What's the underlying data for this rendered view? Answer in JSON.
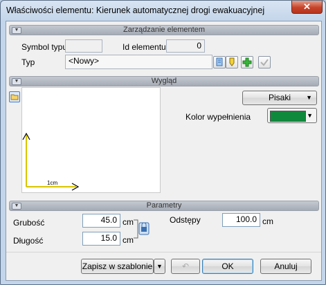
{
  "window": {
    "title": "Właściwości elementu: Kierunek automatycznej drogi ewakuacyjnej",
    "close_label": "✕"
  },
  "sections": {
    "management": "Zarządzanie elementem",
    "appearance": "Wygląd",
    "parameters": "Parametry"
  },
  "management": {
    "symbol_label": "Symbol typu",
    "symbol_value": "",
    "id_label": "Id elementu",
    "id_value": "0",
    "type_label": "Typ",
    "type_value": "<Nowy>"
  },
  "appearance": {
    "pens_button": "Pisaki",
    "fill_color_label": "Kolor wypełnienia",
    "fill_color": "#0f8a3c",
    "scale_label": "1cm"
  },
  "parameters": {
    "thickness_label": "Grubość",
    "thickness_value": "45.0",
    "thickness_unit": "cm",
    "length_label": "Długość",
    "length_value": "15.0",
    "length_unit": "cm",
    "spacing_label": "Odstępy",
    "spacing_value": "100.0",
    "spacing_unit": "cm"
  },
  "footer": {
    "save_template": "Zapisz w szablonie",
    "ok": "OK",
    "cancel": "Anuluj"
  },
  "colors": {
    "accent_axis": "#d8c400"
  }
}
